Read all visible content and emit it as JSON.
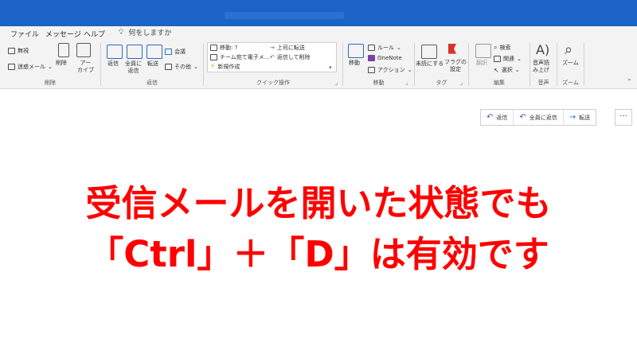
{
  "tabs": [
    "ファイル",
    "メッセージ",
    "ヘルプ"
  ],
  "tell_me": "何をしますか",
  "ribbon": {
    "delete_group": {
      "label": "削除",
      "ignore": "無視",
      "junk": "迷惑メール",
      "delete": "削除",
      "archive_line1": "アー",
      "archive_line2": "カイブ"
    },
    "respond_group": {
      "label": "返信",
      "reply": "返信",
      "reply_all_line1": "全員に",
      "reply_all_line2": "返信",
      "forward": "転送",
      "meeting": "会議",
      "more": "その他"
    },
    "quick_steps": {
      "label": "クイック操作",
      "items": [
        "移動: ?",
        "チーム宛て電子メ...",
        "新規作成",
        "上司に転送",
        "返信して削除"
      ]
    },
    "move_group": {
      "label": "移動",
      "move": "移動",
      "rules": "ルール",
      "onenote": "OneNote",
      "actions": "アクション"
    },
    "tags_group": {
      "label": "タグ",
      "unread": "未読にする",
      "flag_line1": "フラグの",
      "flag_line2": "設定"
    },
    "editing_group": {
      "label": "編集",
      "translate": "翻訳",
      "find": "検索",
      "related": "関連",
      "select": "選択"
    },
    "speech_group": {
      "label": "音声",
      "read_line1": "音声読",
      "read_line2": "み上げ"
    },
    "zoom_group": {
      "label": "ズーム",
      "zoom": "ズーム"
    }
  },
  "message_actions": {
    "reply": "返信",
    "reply_all": "全員に返信",
    "forward": "転送",
    "more": "···"
  },
  "caption": {
    "line1": "受信メールを開いた状態でも",
    "line2": "「Ctrl」＋「D」は有効です"
  },
  "colors": {
    "titlebar": "#1b63c6",
    "caption": "#ff0000",
    "ribbon_bg": "#f3f3f3"
  }
}
